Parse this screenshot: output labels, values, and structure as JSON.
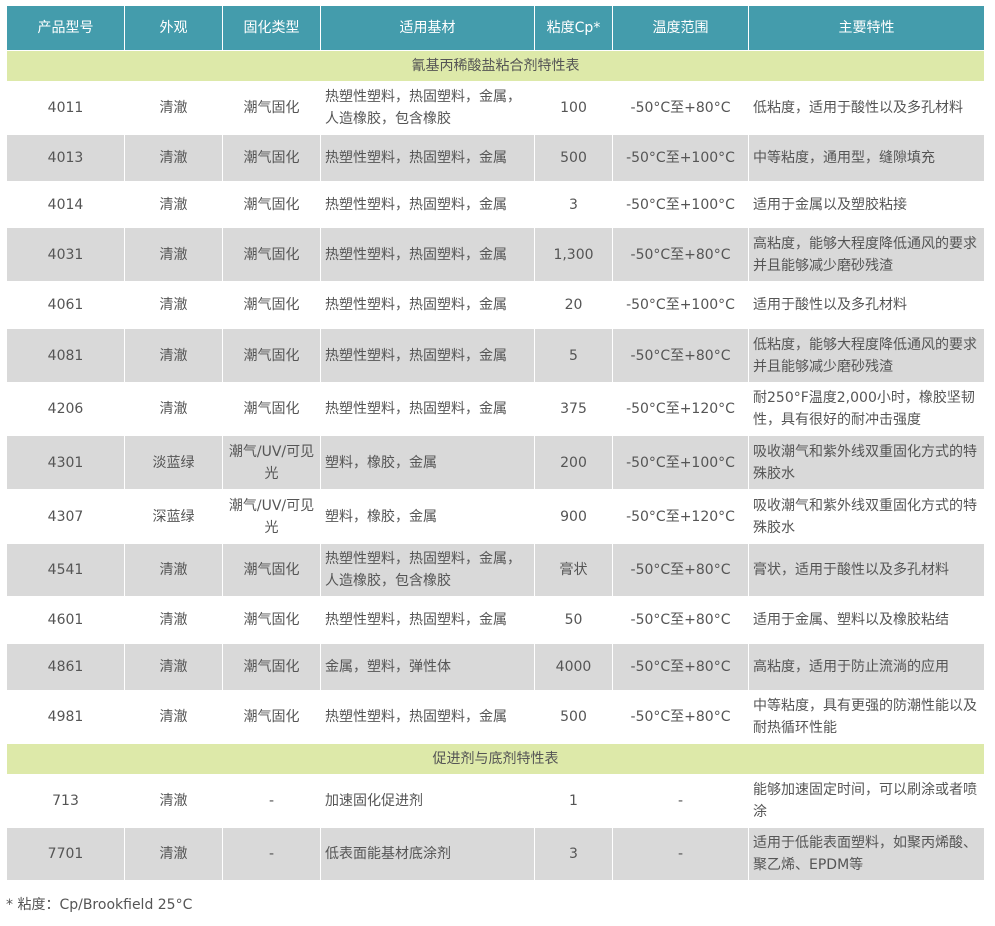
{
  "headers": [
    "产品型号",
    "外观",
    "固化类型",
    "适用基材",
    "粘度Cp*",
    "温度范围",
    "主要特性"
  ],
  "sections": [
    {
      "title": "氰基丙稀酸盐粘合剂特性表",
      "rows": [
        {
          "model": "4011",
          "appearance": "清澈",
          "cure": "潮气固化",
          "substrate": "热塑性塑料，热固塑料，金属，人造橡胶，包含橡胶",
          "viscosity": "100",
          "temp": "-50°C至+80°C",
          "feature": "低粘度，适用于酸性以及多孔材料"
        },
        {
          "model": "4013",
          "appearance": "清澈",
          "cure": "潮气固化",
          "substrate": "热塑性塑料，热固塑料，金属",
          "viscosity": "500",
          "temp": "-50°C至+100°C",
          "feature": "中等粘度，通用型，缝隙填充"
        },
        {
          "model": "4014",
          "appearance": "清澈",
          "cure": "潮气固化",
          "substrate": "热塑性塑料，热固塑料，金属",
          "viscosity": "3",
          "temp": "-50°C至+100°C",
          "feature": "适用于金属以及塑胶粘接"
        },
        {
          "model": "4031",
          "appearance": "清澈",
          "cure": "潮气固化",
          "substrate": "热塑性塑料，热固塑料，金属",
          "viscosity": "1,300",
          "temp": "-50°C至+80°C",
          "feature": "高粘度，能够大程度降低通风的要求并且能够减少磨砂残渣"
        },
        {
          "model": "4061",
          "appearance": "清澈",
          "cure": "潮气固化",
          "substrate": "热塑性塑料，热固塑料，金属",
          "viscosity": "20",
          "temp": "-50°C至+100°C",
          "feature": "适用于酸性以及多孔材料"
        },
        {
          "model": "4081",
          "appearance": "清澈",
          "cure": "潮气固化",
          "substrate": "热塑性塑料，热固塑料，金属",
          "viscosity": "5",
          "temp": "-50°C至+80°C",
          "feature": "低粘度，能够大程度降低通风的要求并且能够减少磨砂残渣"
        },
        {
          "model": "4206",
          "appearance": "清澈",
          "cure": "潮气固化",
          "substrate": "热塑性塑料，热固塑料，金属",
          "viscosity": "375",
          "temp": "-50°C至+120°C",
          "feature": "耐250°F温度2,000小时，橡胶坚韧性，具有很好的耐冲击强度"
        },
        {
          "model": "4301",
          "appearance": "淡蓝绿",
          "cure": "潮气/UV/可见光",
          "substrate": "塑料，橡胶，金属",
          "viscosity": "200",
          "temp": "-50°C至+100°C",
          "feature": "吸收潮气和紫外线双重固化方式的特殊胶水"
        },
        {
          "model": "4307",
          "appearance": "深蓝绿",
          "cure": "潮气/UV/可见光",
          "substrate": "塑料，橡胶，金属",
          "viscosity": "900",
          "temp": "-50°C至+120°C",
          "feature": "吸收潮气和紫外线双重固化方式的特殊胶水"
        },
        {
          "model": "4541",
          "appearance": "清澈",
          "cure": "潮气固化",
          "substrate": "热塑性塑料，热固塑料，金属，人造橡胶，包含橡胶",
          "viscosity": "膏状",
          "temp": "-50°C至+80°C",
          "feature": "膏状，适用于酸性以及多孔材料"
        },
        {
          "model": "4601",
          "appearance": "清澈",
          "cure": "潮气固化",
          "substrate": "热塑性塑料，热固塑料，金属",
          "viscosity": "50",
          "temp": "-50°C至+80°C",
          "feature": "适用于金属、塑料以及橡胶粘结"
        },
        {
          "model": "4861",
          "appearance": "清澈",
          "cure": "潮气固化",
          "substrate": "金属，塑料，弹性体",
          "viscosity": "4000",
          "temp": "-50°C至+80°C",
          "feature": "高粘度，适用于防止流淌的应用"
        },
        {
          "model": "4981",
          "appearance": "清澈",
          "cure": "潮气固化",
          "substrate": "热塑性塑料，热固塑料，金属",
          "viscosity": "500",
          "temp": "-50°C至+80°C",
          "feature": "中等粘度，具有更强的防潮性能以及耐热循环性能"
        }
      ]
    },
    {
      "title": "促进剂与底剂特性表",
      "rows": [
        {
          "model": "713",
          "appearance": "清澈",
          "cure": "-",
          "substrate": "加速固化促进剂",
          "viscosity": "1",
          "temp": "-",
          "feature": "能够加速固定时间，可以刷涂或者喷涂"
        },
        {
          "model": "7701",
          "appearance": "清澈",
          "cure": "-",
          "substrate": "低表面能基材底涂剂",
          "viscosity": "3",
          "temp": "-",
          "feature": "适用于低能表面塑料，如聚丙烯酸、聚乙烯、EPDM等"
        }
      ]
    }
  ],
  "footnote": "* 粘度：Cp/Brookfield 25°C",
  "colors": {
    "header_bg": "#449cac",
    "section_bg": "#dde9a9",
    "stripe_bg": "#d9d9d9",
    "text": "#555555"
  }
}
